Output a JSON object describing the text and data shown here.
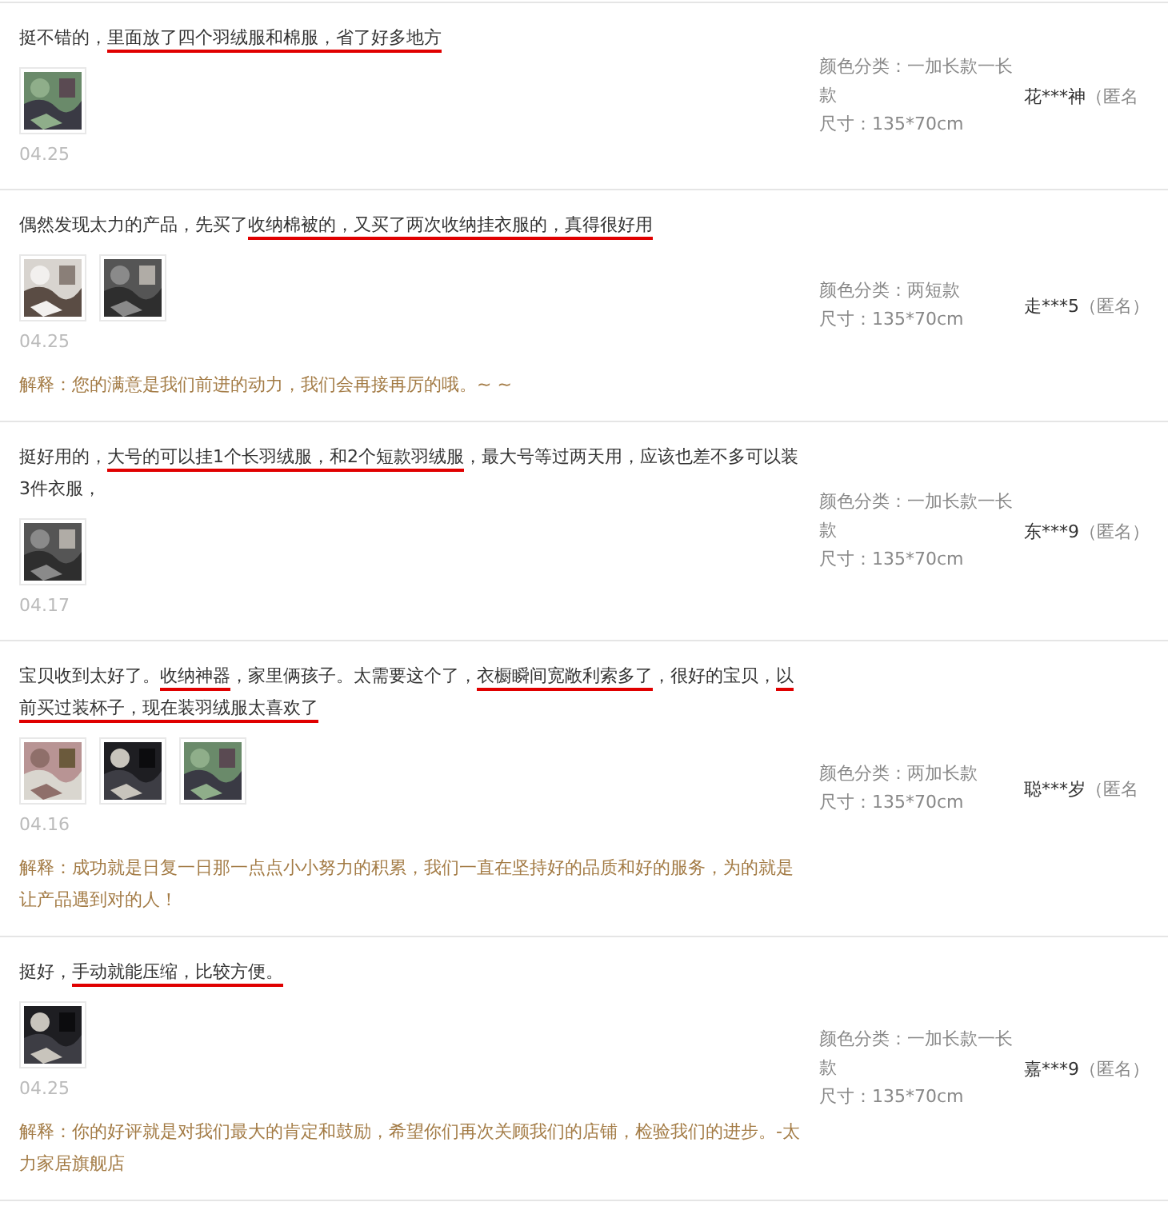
{
  "reviews": [
    {
      "text": [
        {
          "t": "挺不错的，",
          "marked": false
        },
        {
          "t": "里面放了四个羽绒服和棉服，省了好多地方",
          "marked": true
        }
      ],
      "photos": [
        {
          "kind": "picture"
        }
      ],
      "date": "04.25",
      "spec": [
        "颜色分类：一加长款一长款",
        "尺寸：135*70cm"
      ],
      "user": "花***神",
      "anon": "（匿名"
    },
    {
      "text": [
        {
          "t": "偶然发现太力的产品，先买了",
          "marked": false
        },
        {
          "t": "收纳棉被的，又买了两次收纳挂衣服的，真得很好用",
          "marked": true
        }
      ],
      "photos": [
        {
          "kind": "picture"
        },
        {
          "kind": "picture"
        }
      ],
      "date": "04.25",
      "reply": "解释：您的满意是我们前进的动力，我们会再接再厉的哦。~ ~",
      "spec": [
        "颜色分类：两短款",
        "尺寸：135*70cm"
      ],
      "user": "走***5",
      "anon": "（匿名）"
    },
    {
      "text": [
        {
          "t": "挺好用的，",
          "marked": false
        },
        {
          "t": "大号的可以挂1个长羽绒服，和2个短款羽绒服",
          "marked": true
        },
        {
          "t": "，最大号等过两天用，应该也差不多可以装3件衣服，",
          "marked": false
        }
      ],
      "photos": [
        {
          "kind": "picture"
        }
      ],
      "date": "04.17",
      "spec": [
        "颜色分类：一加长款一长款",
        "尺寸：135*70cm"
      ],
      "user": "东***9",
      "anon": "（匿名）"
    },
    {
      "text": [
        {
          "t": "宝贝收到太好了。",
          "marked": false
        },
        {
          "t": "收纳神器",
          "marked": true
        },
        {
          "t": "，家里俩孩子。太需要这个了，",
          "marked": false
        },
        {
          "t": "衣橱瞬间宽敞利索多了",
          "marked": true
        },
        {
          "t": "，很好的宝贝，",
          "marked": false
        },
        {
          "t": "以前买过装杯子，现在装羽绒服太喜欢了",
          "marked": true
        }
      ],
      "photos": [
        {
          "kind": "picture"
        },
        {
          "kind": "picture"
        },
        {
          "kind": "picture"
        }
      ],
      "date": "04.16",
      "reply": "解释：成功就是日复一日那一点点小小努力的积累，我们一直在坚持好的品质和好的服务，为的就是让产品遇到对的人！",
      "spec": [
        "颜色分类：两加长款",
        "尺寸：135*70cm"
      ],
      "user": "聪***岁",
      "anon": "（匿名"
    },
    {
      "text": [
        {
          "t": "挺好，",
          "marked": false
        },
        {
          "t": "手动就能压缩，比较方便。",
          "marked": true
        }
      ],
      "photos": [
        {
          "kind": "picture"
        }
      ],
      "date": "04.25",
      "reply": "解释：你的好评就是对我们最大的肯定和鼓励，希望你们再次关顾我们的店铺，检验我们的进步。-太力家居旗舰店",
      "spec": [
        "颜色分类：一加长款一长款",
        "尺寸：135*70cm"
      ],
      "user": "嘉***9",
      "anon": "（匿名）"
    }
  ]
}
